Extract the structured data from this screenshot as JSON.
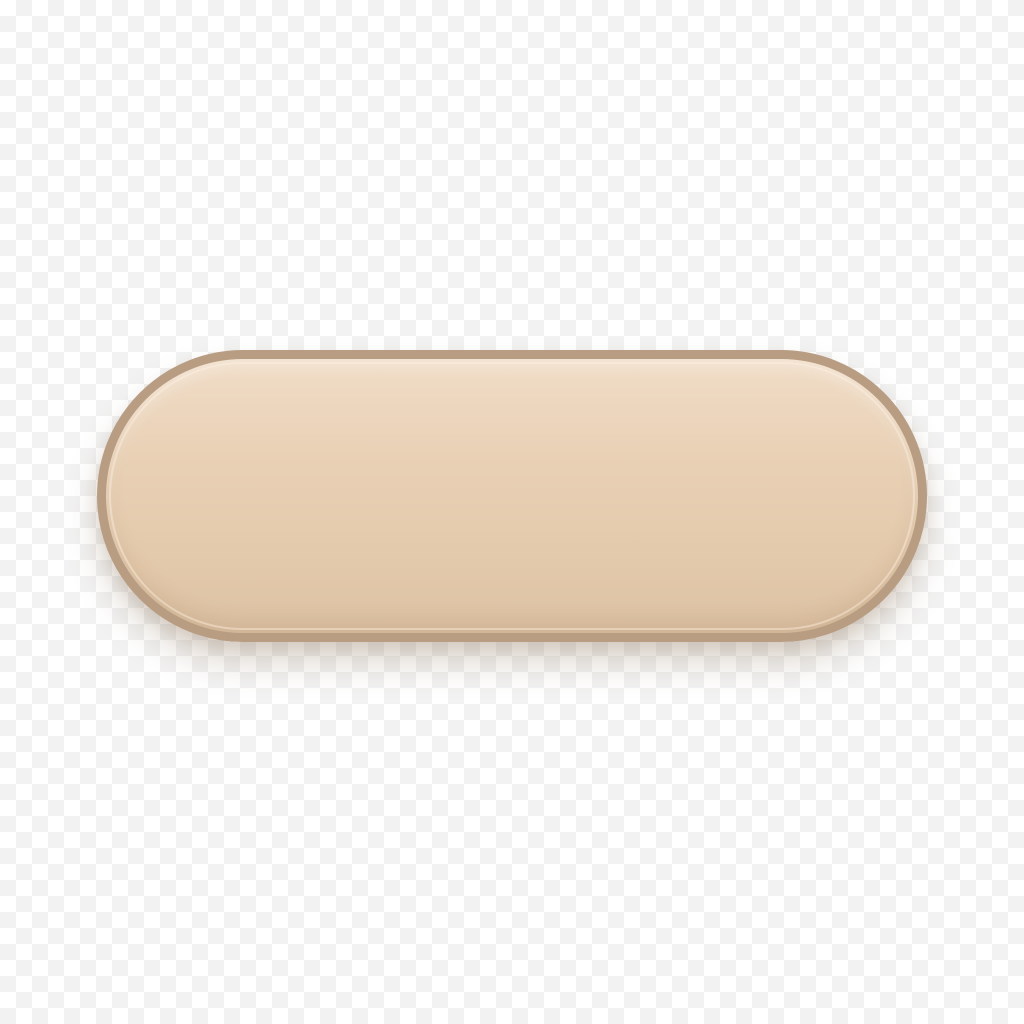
{
  "button": {
    "label": "",
    "fill_color": "#e6cdb1",
    "border_color": "#b89d82"
  },
  "background": {
    "pattern": "transparency-checkerboard",
    "light_color": "#ffffff",
    "dark_color": "#f2f2f2"
  }
}
